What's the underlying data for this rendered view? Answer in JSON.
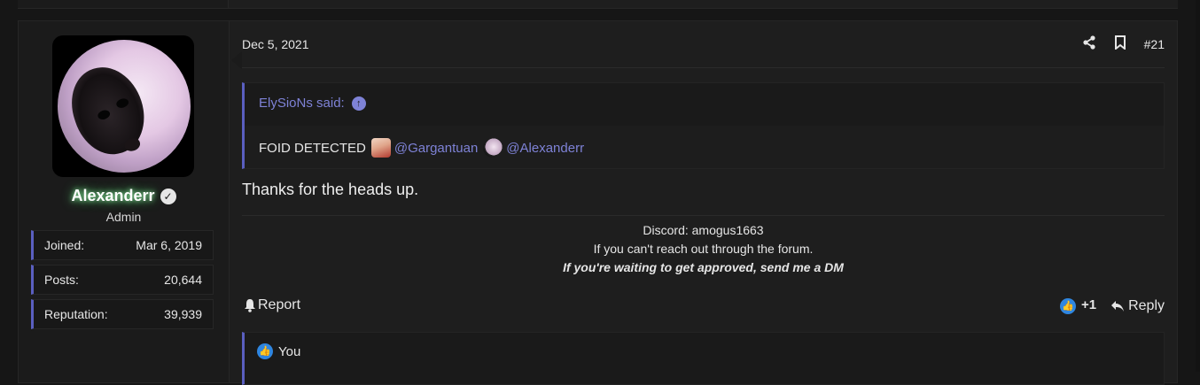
{
  "post": {
    "date": "Dec 5, 2021",
    "number": "#21",
    "user": {
      "name": "Alexanderr",
      "title": "Admin",
      "stats": [
        {
          "label": "Joined:",
          "value": "Mar 6, 2019"
        },
        {
          "label": "Posts:",
          "value": "20,644"
        },
        {
          "label": "Reputation:",
          "value": "39,939"
        }
      ]
    },
    "quote": {
      "author_said": "ElySioNs said:",
      "text": "FOID DETECTED",
      "mention1": "@Gargantuan",
      "mention2": "@Alexanderr"
    },
    "message": "Thanks for the heads up.",
    "signature": {
      "line1": "Discord: amogus1663",
      "line2": "If you can't reach out through the forum.",
      "line3": "If you're waiting to get approved, send me a DM"
    },
    "actions": {
      "report": "Report",
      "like_count": "+1",
      "reply": "Reply"
    },
    "reactions": {
      "text": "You"
    }
  },
  "colors": {
    "accent": "#5a5fc0",
    "link": "#7e82d6",
    "like": "#2f86e0",
    "background": "#161616"
  },
  "icons": [
    "share-icon",
    "bookmark-icon",
    "verified-icon",
    "arrow-up-icon",
    "bell-icon",
    "like-icon",
    "reply-icon"
  ]
}
